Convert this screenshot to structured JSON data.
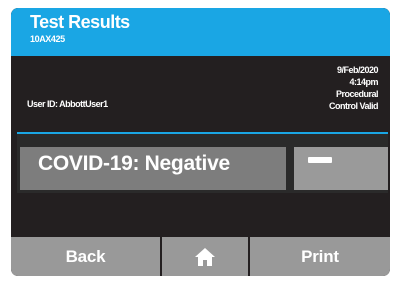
{
  "header": {
    "title": "Test Results",
    "subtitle": "10AX425"
  },
  "info": {
    "user_id": "User ID: AbbottUser1",
    "date": "9/Feb/2020",
    "time": "4:14pm",
    "control_line1": "Procedural",
    "control_line2": "Control Valid"
  },
  "result": {
    "text": "COVID-19: Negative",
    "symbol_icon": "minus-icon"
  },
  "footer": {
    "back_label": "Back",
    "home_icon": "home-icon",
    "print_label": "Print"
  },
  "colors": {
    "accent": "#1aa6e4",
    "screen_background": "#231f20",
    "button_gray": "#999999"
  }
}
